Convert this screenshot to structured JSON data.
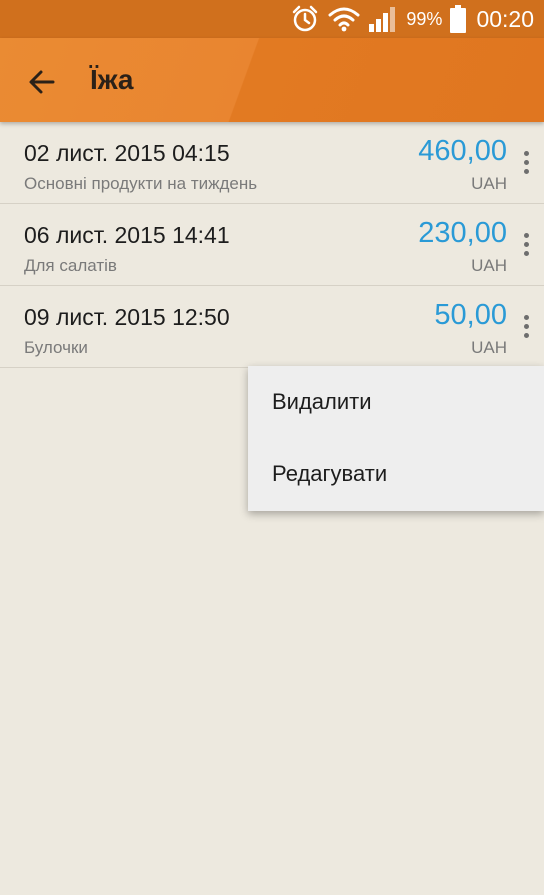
{
  "status_bar": {
    "battery_percent": "99%",
    "time": "00:20",
    "icons": [
      "alarm-icon",
      "wifi-icon",
      "signal-icon",
      "battery-icon"
    ]
  },
  "app_bar": {
    "title": "Їжа",
    "back_icon": "arrow-left-icon"
  },
  "transactions": [
    {
      "date": "02 лист. 2015 04:15",
      "description": "Основні продукти на тиждень",
      "amount": "460,00",
      "currency": "UAH"
    },
    {
      "date": "06 лист. 2015 14:41",
      "description": "Для салатів",
      "amount": "230,00",
      "currency": "UAH"
    },
    {
      "date": "09 лист. 2015 12:50",
      "description": "Булочки",
      "amount": "50,00",
      "currency": "UAH"
    }
  ],
  "popup_menu": {
    "items": [
      "Видалити",
      "Редагувати"
    ]
  },
  "colors": {
    "status_bar": "#d0701d",
    "app_bar": "#e8832c",
    "amount": "#2a9ad6",
    "background": "#ede9df"
  }
}
